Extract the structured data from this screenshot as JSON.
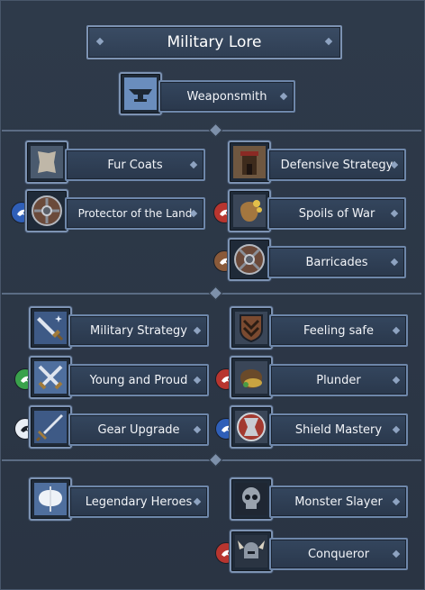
{
  "title": "Military Lore",
  "top": {
    "label": "Weaponsmith",
    "icon": "anvil-icon"
  },
  "nodes": [
    {
      "id": "fur-coats",
      "label": "Fur Coats",
      "icon": "fur-icon"
    },
    {
      "id": "defensive-strategy",
      "label": "Defensive Strategy",
      "icon": "tower-icon"
    },
    {
      "id": "protector-of-the-land",
      "label": "Protector of the Land",
      "icon": "round-shield-icon",
      "badge": "blue"
    },
    {
      "id": "spoils-of-war",
      "label": "Spoils of War",
      "icon": "loot-sack-icon",
      "badge": "red"
    },
    {
      "id": "barricades",
      "label": "Barricades",
      "icon": "round-shield-icon",
      "badge": "brown"
    },
    {
      "id": "military-strategy",
      "label": "Military Strategy",
      "icon": "sword-icon"
    },
    {
      "id": "feeling-safe",
      "label": "Feeling safe",
      "icon": "chevron-shield-icon"
    },
    {
      "id": "young-and-proud",
      "label": "Young and Proud",
      "icon": "crossed-swords-icon",
      "badge": "green"
    },
    {
      "id": "plunder",
      "label": "Plunder",
      "icon": "treasure-sack-icon",
      "badge": "red"
    },
    {
      "id": "gear-upgrade",
      "label": "Gear Upgrade",
      "icon": "sword-icon",
      "badge": "white"
    },
    {
      "id": "shield-mastery",
      "label": "Shield Mastery",
      "icon": "red-shield-icon",
      "badge": "blue"
    },
    {
      "id": "legendary-heroes",
      "label": "Legendary Heroes",
      "icon": "battle-axe-icon"
    },
    {
      "id": "monster-slayer",
      "label": "Monster Slayer",
      "icon": "skull-icon"
    },
    {
      "id": "conqueror",
      "label": "Conqueror",
      "icon": "horned-helmet-icon",
      "badge": "red"
    }
  ],
  "colors": {
    "background": "#2b3645",
    "border": "#7d93b3",
    "badge_blue": "#2f5fb8",
    "badge_red": "#b8352f",
    "badge_brown": "#8a5a3a",
    "badge_green": "#3aa24c",
    "badge_white": "#e9eef5"
  }
}
